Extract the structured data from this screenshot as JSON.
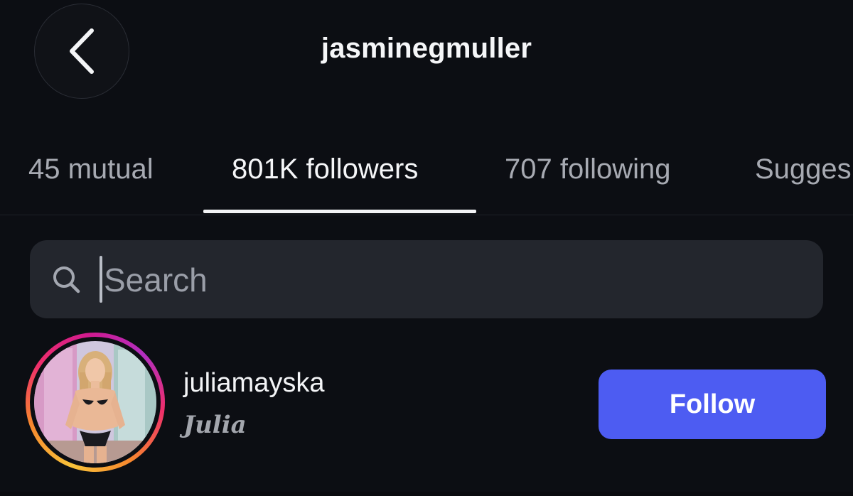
{
  "header": {
    "title": "jasminegmuller",
    "back_icon": "chevron-left-icon"
  },
  "tabs": [
    {
      "label": "45 mutual",
      "active": false
    },
    {
      "label": "801K followers",
      "active": true
    },
    {
      "label": "707 following",
      "active": false
    },
    {
      "label": "Sugges",
      "active": false
    }
  ],
  "search": {
    "placeholder": "Search",
    "value": "",
    "icon": "search-icon"
  },
  "list": {
    "items": [
      {
        "username": "juliamayska",
        "display_name": "Julia",
        "action_label": "Follow",
        "has_story_ring": true
      }
    ]
  },
  "colors": {
    "background": "#0c0e13",
    "search_bg": "#23262d",
    "follow_button": "#4d5cf2",
    "tab_inactive": "#a7aab2",
    "tab_active": "#f5f6f8"
  }
}
